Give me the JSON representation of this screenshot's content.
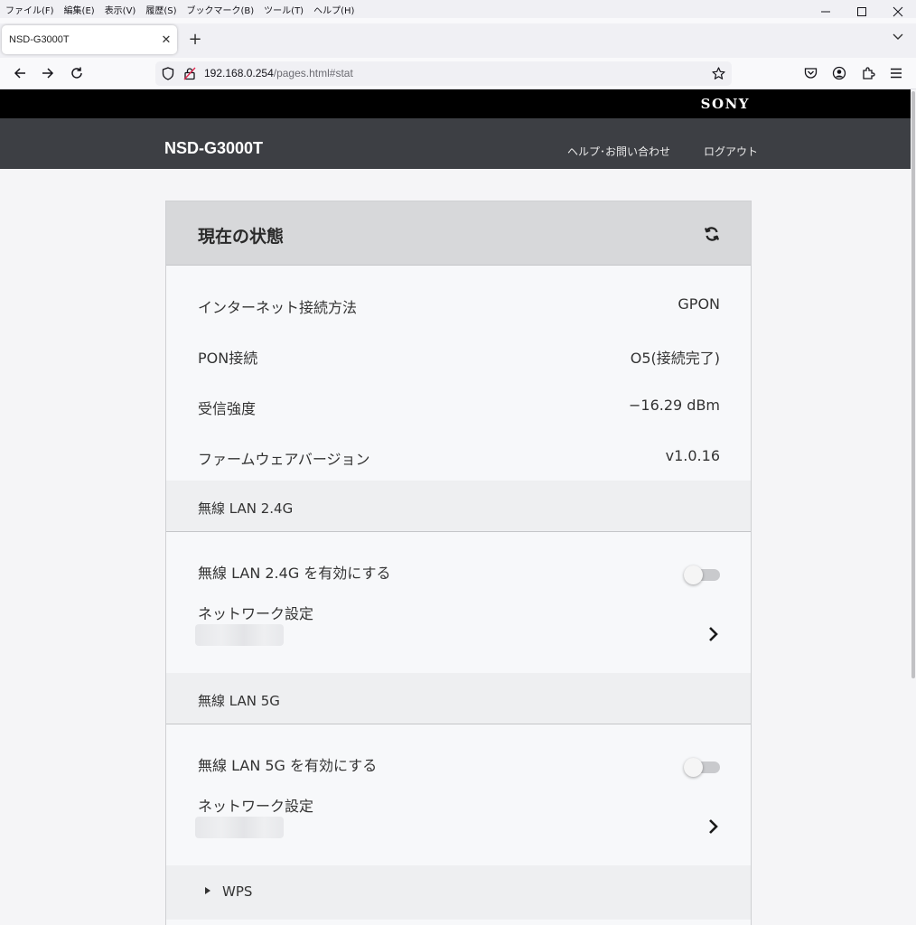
{
  "browser": {
    "menu": [
      "ファイル(F)",
      "編集(E)",
      "表示(V)",
      "履歴(S)",
      "ブックマーク(B)",
      "ツール(T)",
      "ヘルプ(H)"
    ],
    "tab_title": "NSD-G3000T",
    "url_host": "192.168.0.254",
    "url_path": "/pages.html#stat"
  },
  "header": {
    "brand": "SONY",
    "product": "NSD-G3000T",
    "help_link": "ヘルプ･お問い合わせ",
    "logout_link": "ログアウト"
  },
  "status": {
    "title": "現在の状態",
    "rows": [
      {
        "label": "インターネット接続方法",
        "value": "GPON"
      },
      {
        "label": "PON接続",
        "value": "O5(接続完了)"
      },
      {
        "label": "受信強度",
        "value": "−16.29 dBm"
      },
      {
        "label": "ファームウェアバージョン",
        "value": "v1.0.16"
      }
    ]
  },
  "wlan24": {
    "section_title": "無線 LAN 2.4G",
    "toggle_label": "無線 LAN 2.4G を有効にする",
    "toggle_on": false,
    "network_label": "ネットワーク設定"
  },
  "wlan5": {
    "section_title": "無線 LAN 5G",
    "toggle_label": "無線 LAN 5G を有効にする",
    "toggle_on": false,
    "network_label": "ネットワーク設定"
  },
  "wps": {
    "label": "WPS"
  }
}
